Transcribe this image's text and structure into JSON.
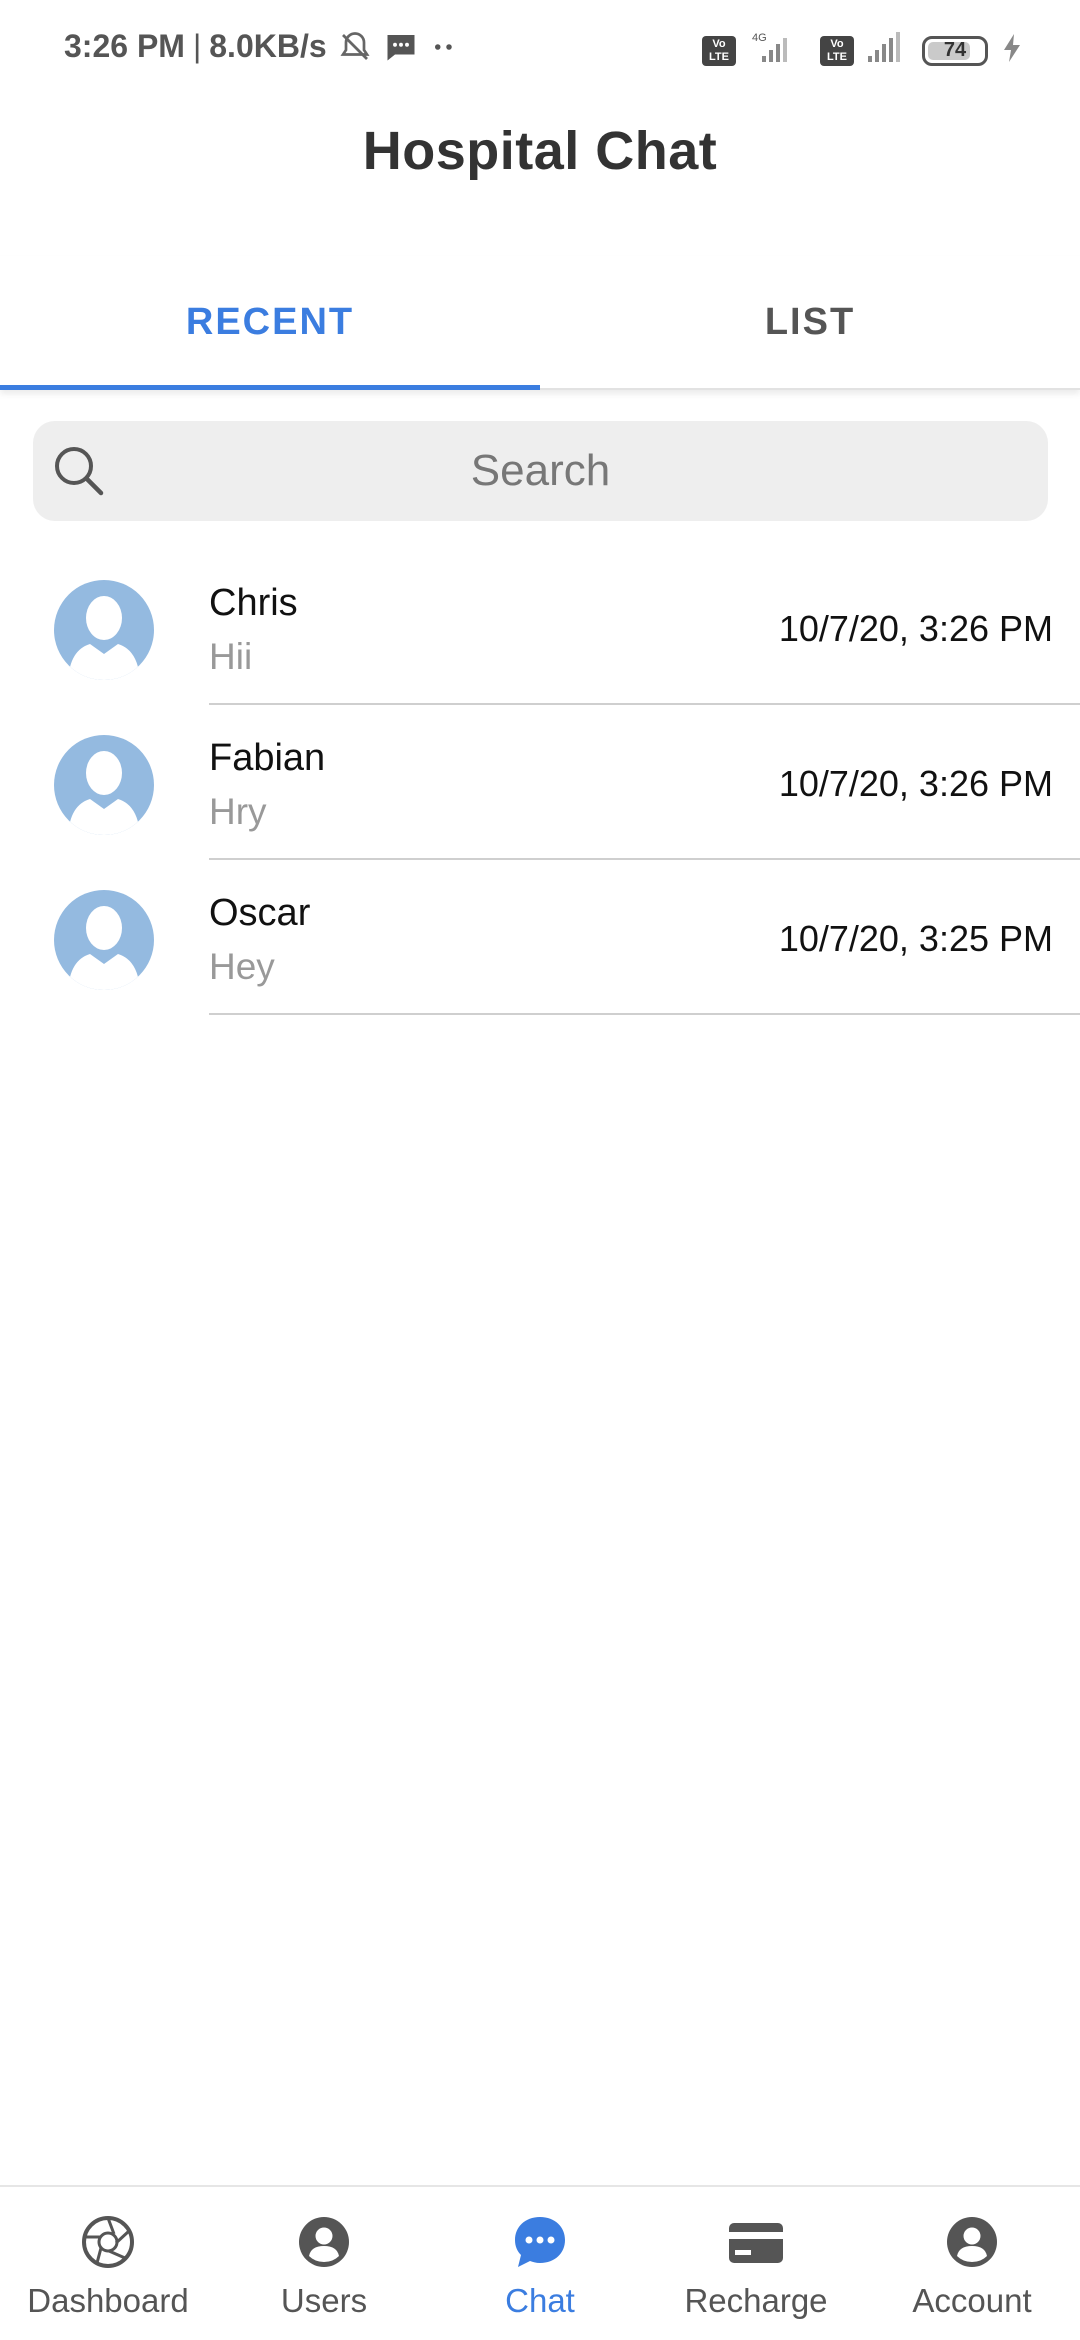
{
  "status_bar": {
    "time": "3:26 PM",
    "separator": "|",
    "speed": "8.0KB/s",
    "network_type": "4G",
    "volte_label": "Vo LTE",
    "battery": "74",
    "icons": [
      "bell-muted-icon",
      "message-icon",
      "more-dots-icon",
      "signal-icon",
      "battery-icon",
      "charging-icon"
    ]
  },
  "header": {
    "title": "Hospital Chat"
  },
  "tabs": [
    {
      "label": "RECENT",
      "active": true
    },
    {
      "label": "LIST",
      "active": false
    }
  ],
  "search": {
    "placeholder": "Search",
    "icon": "search-icon"
  },
  "chats": [
    {
      "name": "Chris",
      "message": "Hii",
      "time": "10/7/20, 3:26 PM"
    },
    {
      "name": "Fabian",
      "message": "Hry",
      "time": "10/7/20, 3:26 PM"
    },
    {
      "name": "Oscar",
      "message": "Hey",
      "time": "10/7/20, 3:25 PM"
    }
  ],
  "bottom_nav": [
    {
      "label": "Dashboard",
      "icon": "aperture-icon",
      "active": false
    },
    {
      "label": "Users",
      "icon": "user-circle-icon",
      "active": false
    },
    {
      "label": "Chat",
      "icon": "chat-bubble-icon",
      "active": true
    },
    {
      "label": "Recharge",
      "icon": "card-icon",
      "active": false
    },
    {
      "label": "Account",
      "icon": "account-circle-icon",
      "active": false
    }
  ],
  "colors": {
    "accent": "#3b7de0",
    "avatar_bg": "#94bae0",
    "search_bg": "#eeeeee"
  }
}
